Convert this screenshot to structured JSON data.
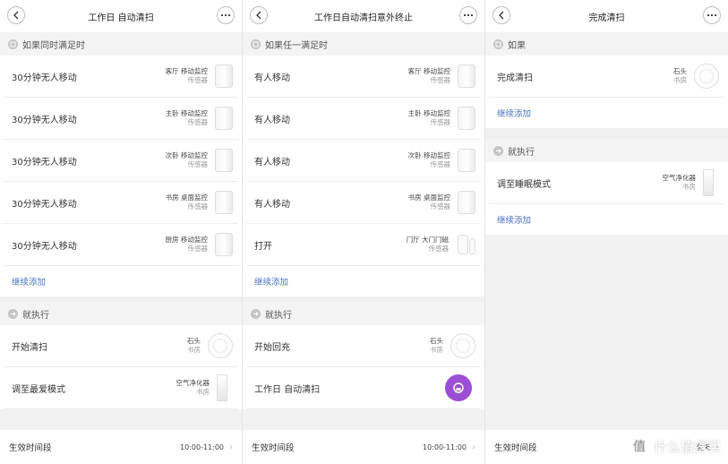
{
  "panels": [
    {
      "title": "工作日 自动清扫",
      "condition_header": "如果同时满足时",
      "conditions": [
        {
          "label": "30分钟无人移动",
          "device": "客厅 移动监控",
          "type": "传感器"
        },
        {
          "label": "30分钟无人移动",
          "device": "主卧 移动监控",
          "type": "传感器"
        },
        {
          "label": "30分钟无人移动",
          "device": "次卧 移动监控",
          "type": "传感器"
        },
        {
          "label": "30分钟无人移动",
          "device": "书房 桌面监控",
          "type": "传感器"
        },
        {
          "label": "30分钟无人移动",
          "device": "厨房 移动监控",
          "type": "传感器"
        }
      ],
      "add_label": "继续添加",
      "action_header": "就执行",
      "actions": [
        {
          "label": "开始清扫",
          "device": "石头",
          "room": "书房"
        },
        {
          "label": "调至最爱模式",
          "device": "空气净化器",
          "room": "书房"
        }
      ],
      "footer_label": "生效时间段",
      "footer_value": "10:00-11:00"
    },
    {
      "title": "工作日自动清扫意外终止",
      "condition_header": "如果任一满足时",
      "conditions": [
        {
          "label": "有人移动",
          "device": "客厅 移动监控",
          "type": "传感器"
        },
        {
          "label": "有人移动",
          "device": "主卧 移动监控",
          "type": "传感器"
        },
        {
          "label": "有人移动",
          "device": "次卧 移动监控",
          "type": "传感器"
        },
        {
          "label": "有人移动",
          "device": "书房 桌面监控",
          "type": "传感器"
        },
        {
          "label": "打开",
          "device": "门厅 大门门磁",
          "type": "传感器"
        }
      ],
      "add_label": "继续添加",
      "action_header": "就执行",
      "actions": [
        {
          "label": "开始回充",
          "device": "石头",
          "room": "书房"
        },
        {
          "label": "工作日 自动清扫",
          "device": "",
          "room": ""
        }
      ],
      "footer_label": "生效时间段",
      "footer_value": "10:00-11:00"
    },
    {
      "title": "完成清扫",
      "condition_header": "如果",
      "conditions": [
        {
          "label": "完成清扫",
          "device": "石头",
          "type": "书房"
        }
      ],
      "add_label": "继续添加",
      "action_header": "就执行",
      "actions": [
        {
          "label": "调至睡眠模式",
          "device": "空气净化器",
          "room": "书房"
        }
      ],
      "add_label_2": "继续添加",
      "footer_label": "生效时间段",
      "footer_value": "全天"
    }
  ],
  "watermark": "什么值得买",
  "colors": {
    "link": "#4a73c7",
    "fab": "#9b4fd6"
  },
  "icons": {
    "back": "chevron-left-icon",
    "more": "more-dots-icon"
  }
}
